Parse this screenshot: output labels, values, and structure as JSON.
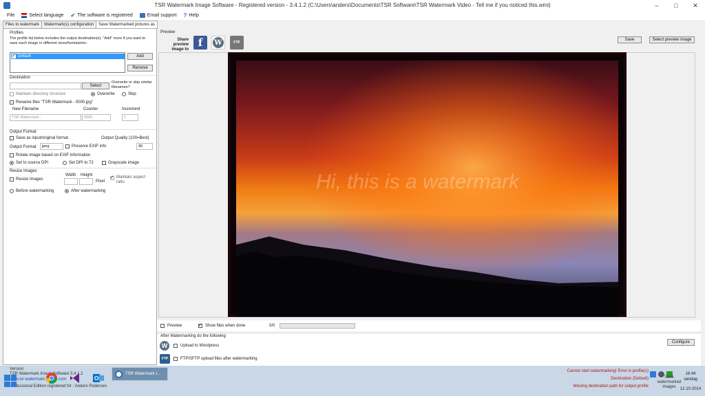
{
  "window": {
    "title": "TSR Watermark Image Software - Registered version - 3.4.1.2 (C:\\Users\\anders\\Documents\\TSR Software\\TSR Watermark Video - Tell me if you noticed this.wmi)"
  },
  "menu": {
    "file": "File",
    "language": "Select language",
    "registered": "The software is registered",
    "email": "Email support",
    "help": "Help"
  },
  "tabs": [
    "Files to watermark",
    "Watermark(s) configuration",
    "Save Watermarked pictures as"
  ],
  "profiles": {
    "heading": "Profiles",
    "description": "The profile list below includes the output destination(s). \"Add\" more if you want to save each image in different sizes/formats/etc.",
    "items": [
      "Default"
    ],
    "add": "Add",
    "remove": "Remove"
  },
  "destination": {
    "heading": "Destination",
    "select": "Select",
    "overwrite_question": "Overwrite or skip similar filenames?",
    "maintain": "Maintain directory structure",
    "overwrite": "Overwrite",
    "skip": "Skip",
    "rename": "Rename files \"TSR Watermark - 0000.jpg\"",
    "new_filename_label": "New Filename",
    "counter_label": "Counter",
    "increment_label": "Increment",
    "new_filename_value": "TSR Watermark -",
    "counter_value": "0000",
    "increment_value": "1"
  },
  "output_format": {
    "heading": "Output Format",
    "save_as_input": "Save as input/original format",
    "quality_label": "Output Quality (100=Best)",
    "format_label": "Output Format",
    "format_value": "jpeg",
    "preserve_exif": "Preserve EXIF info",
    "quality_value": "90",
    "rotate": "Rotate image based on EXIF information",
    "dpi_source": "Set to source DPI",
    "dpi_72": "Set DPI to 72",
    "grayscale": "Grayscale image"
  },
  "resize": {
    "heading": "Resize Images",
    "resize_images": "Resize Images",
    "width": "Width",
    "height": "Height",
    "pixel": "Pixel",
    "aspect": "Maintain aspect ratio",
    "before": "Before watermarking",
    "after": "After watermarking"
  },
  "preview": {
    "label": "Preview",
    "share_label": "Share preview image to",
    "save": "Save",
    "select_preview": "Select preview image",
    "watermark_text": "Hi, this is a watermark",
    "preview_check": "Preview",
    "show_files": "Show files when done",
    "count": "0/0"
  },
  "after": {
    "heading": "After Watermarking do the following",
    "upload_wp": "Upload to Wordpress",
    "ftp": "FTP/SFTP upload files after watermarking",
    "configure": "Configure"
  },
  "icons": {
    "facebook": "f",
    "wordpress": "W",
    "ftp": "FTP"
  },
  "status": {
    "version_label": "Version",
    "product": "TSR Watermark Image Software 3.4.1.2",
    "url": "www.tsr-watermark-image.com",
    "edition": "Professional Edition registered for : Anders Pedersen",
    "error1": "Cannot start watermarking! Error in profile(s)",
    "error2": "Destination (Default)",
    "error3": "Missing destination path for output profile",
    "tray_text": "Save watermarked images",
    "time": "16:44",
    "day": "søndag",
    "date": "12-10-2014"
  },
  "taskbar": {
    "active_window": "TSR Watermark I..."
  },
  "colors": {
    "accent": "#3399ff",
    "error": "#b01515",
    "taskbar": "#c9d7e6",
    "facebook": "#3b5998",
    "wordpress": "#5b6f82"
  }
}
